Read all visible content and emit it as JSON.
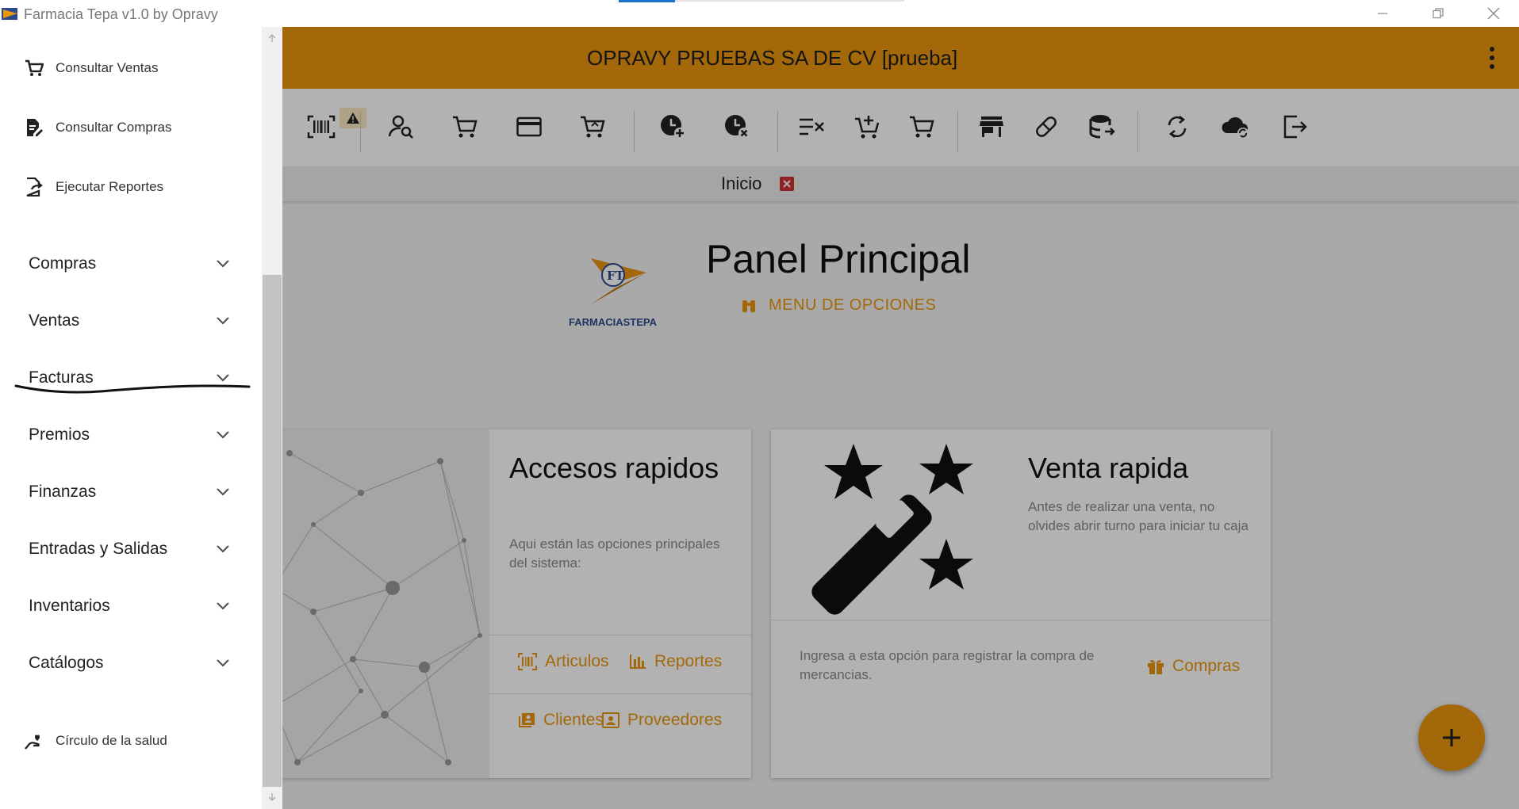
{
  "window": {
    "title": "Farmacia Tepa v1.0 by Opravy"
  },
  "header": {
    "company": "OPRAVY PRUEBAS SA DE CV [prueba]"
  },
  "toolbar": {
    "icons": [
      "barcode-icon",
      "person-search-icon",
      "cart-icon",
      "credit-card-icon",
      "cart-arrow-icon",
      "clock-plus-icon",
      "clock-cancel-icon",
      "list-check-icon",
      "cart-plus-icon",
      "cart-outline-icon",
      "store-icon",
      "pill-icon",
      "database-sync-icon",
      "sync-icon",
      "cloud-sync-icon",
      "logout-icon"
    ],
    "warning_icon": "warning-icon"
  },
  "tabs": [
    {
      "label": "Inicio"
    }
  ],
  "panel": {
    "title": "Panel Principal",
    "menu_label": "MENU DE OPCIONES",
    "logo_text": "FARMACIASTEPA",
    "logo_initials": "FT"
  },
  "cards": {
    "quick_access": {
      "title": "Accesos rapidos",
      "description": "Aqui están las opciones principales del sistema:",
      "links": [
        "Articulos",
        "Reportes",
        "Clientes",
        "Proveedores"
      ]
    },
    "quick_sale": {
      "title": "Venta rapida",
      "description": "Antes de realizar una venta, no olvides abrir turno para iniciar tu caja",
      "footer_text": "Ingresa a esta opción para registrar la compra de mercancias.",
      "link": "Compras"
    }
  },
  "drawer": {
    "items_top": [
      "Consultar Ventas",
      "Consultar Compras",
      "Ejecutar Reportes"
    ],
    "groups": [
      "Compras",
      "Ventas",
      "Facturas",
      "Premios",
      "Finanzas",
      "Entradas y Salidas",
      "Inventarios",
      "Catálogos"
    ],
    "item_bottom": "Círculo de la salud"
  },
  "colors": {
    "accent": "#e8950f",
    "close_red": "#d32f2f"
  }
}
